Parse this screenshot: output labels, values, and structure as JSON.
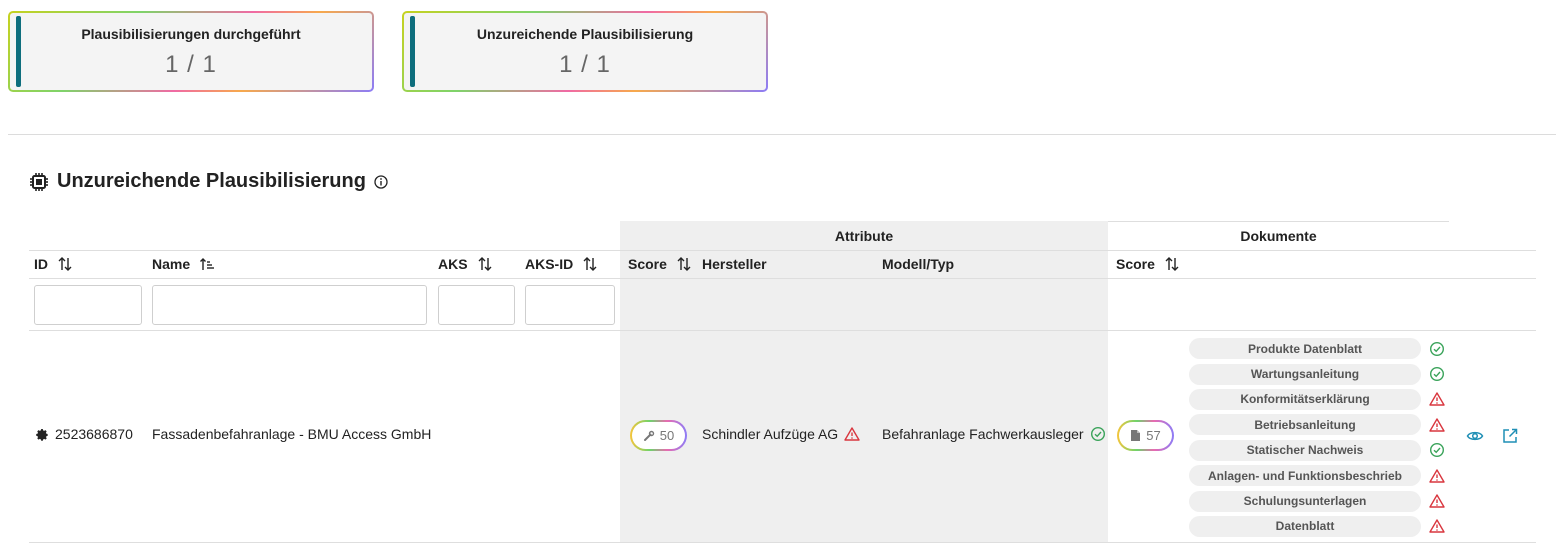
{
  "kpis": [
    {
      "title": "Plausibilisierungen durchgeführt",
      "value": "1 / 1"
    },
    {
      "title": "Unzureichende Plausibilisierung",
      "value": "1 / 1"
    }
  ],
  "section": {
    "title": "Unzureichende Plausibilisierung",
    "icon": "chip-icon"
  },
  "table": {
    "groups": {
      "attribute": "Attribute",
      "dokumente": "Dokumente"
    },
    "columns": {
      "id": "ID",
      "name": "Name",
      "aks": "AKS",
      "aks_id": "AKS-ID",
      "attr_score": "Score",
      "hersteller": "Hersteller",
      "modell": "Modell/Typ",
      "doc_score": "Score"
    },
    "row": {
      "id": "2523686870",
      "name": "Fassadenbefahranlage - BMU Access GmbH",
      "attr_score": "50",
      "hersteller": "Schindler Aufzüge AG",
      "hersteller_status": "warning",
      "modell": "Befahranlage Fachwerkausleger",
      "modell_status": "ok",
      "doc_score": "57",
      "documents": [
        {
          "label": "Produkte Datenblatt",
          "status": "ok"
        },
        {
          "label": "Wartungsanleitung",
          "status": "ok"
        },
        {
          "label": "Konformitätserklärung",
          "status": "warning"
        },
        {
          "label": "Betriebsanleitung",
          "status": "warning"
        },
        {
          "label": "Statischer Nachweis",
          "status": "ok"
        },
        {
          "label": "Anlagen- und Funktionsbeschrieb",
          "status": "warning"
        },
        {
          "label": "Schulungsunterlagen",
          "status": "warning"
        },
        {
          "label": "Datenblatt",
          "status": "warning"
        }
      ]
    }
  },
  "colors": {
    "accent": "#0e6e7d",
    "ok": "#3aa35a",
    "warning": "#d9363e",
    "action": "#1f8fb5"
  }
}
